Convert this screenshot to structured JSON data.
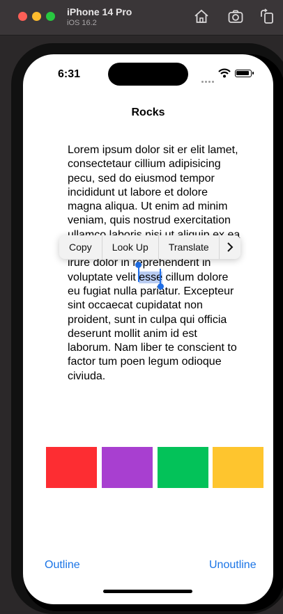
{
  "simulator": {
    "device_name": "iPhone 14 Pro",
    "os_version": "iOS 16.2",
    "toolbar_icons": [
      "home-icon",
      "screenshot-icon",
      "rotate-icon"
    ]
  },
  "status_bar": {
    "time": "6:31"
  },
  "screen": {
    "title": "Rocks",
    "text_before_selection": "Lorem ipsum dolor sit er elit lamet, consectetaur cillium adipisicing pecu, sed do eiusmod tempor incididunt ut labore et dolore magna aliqua. Ut enim ad minim veniam, quis nostrud exercitation ullamco laboris nisi ut aliquip ex ea commodo consequat. Duis aute irure dolor in reprehenderit in voluptate velit ",
    "selected_text": "esse",
    "text_after_selection": " cillum dolore eu fugiat nulla pariatur. Excepteur sint occaecat cupidatat non proident, sunt in culpa qui officia deserunt mollit anim id est laborum. Nam liber te conscient to factor tum poen legum odioque civiuda.",
    "context_menu": {
      "items": [
        "Copy",
        "Look Up",
        "Translate"
      ],
      "more_icon": "chevron-right-icon"
    },
    "swatches": [
      {
        "color": "#fd2d32"
      },
      {
        "color": "#a83fd0"
      },
      {
        "color": "#03c259"
      },
      {
        "color": "#fec52e"
      }
    ],
    "outline_button": "Outline",
    "unoutline_button": "Unoutline"
  }
}
